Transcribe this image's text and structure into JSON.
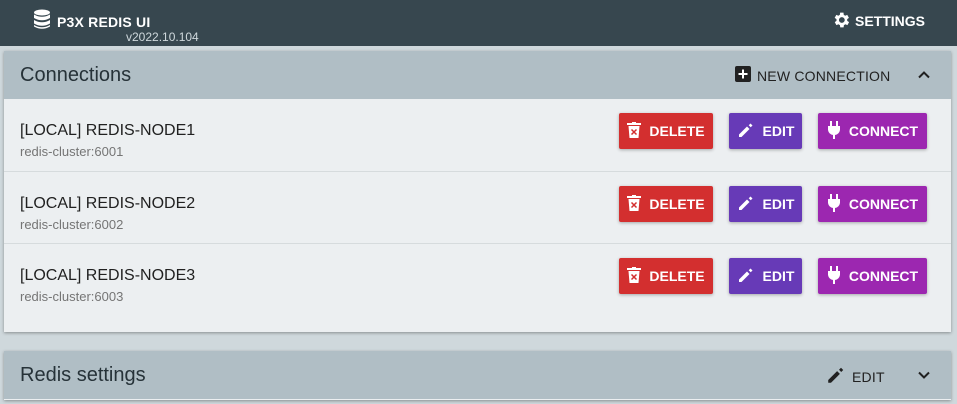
{
  "app": {
    "title": "P3X REDIS UI",
    "version": "v2022.10.104",
    "settings_label": "SETTINGS"
  },
  "connections": {
    "title": "Connections",
    "new_connection_label": "NEW CONNECTION",
    "items": [
      {
        "name": "[LOCAL] REDIS-NODE1",
        "host": "redis-cluster:6001"
      },
      {
        "name": "[LOCAL] REDIS-NODE2",
        "host": "redis-cluster:6002"
      },
      {
        "name": "[LOCAL] REDIS-NODE3",
        "host": "redis-cluster:6003"
      }
    ],
    "delete_label": "DELETE",
    "edit_label": "EDIT",
    "connect_label": "CONNECT"
  },
  "redis_settings": {
    "title": "Redis settings",
    "edit_label": "EDIT"
  },
  "colors": {
    "topbar": "#37474f",
    "panel_header": "#b0bec5",
    "delete": "#d32f2f",
    "edit": "#673ab7",
    "connect": "#9c27b0"
  },
  "icons": {
    "brand": "database-icon",
    "settings": "gear-icon",
    "new_connection": "plus-box-icon",
    "delete": "trash-icon",
    "edit": "pencil-icon",
    "connect": "plug-icon",
    "collapse": "chevron-up-icon",
    "expand": "chevron-down-icon"
  }
}
